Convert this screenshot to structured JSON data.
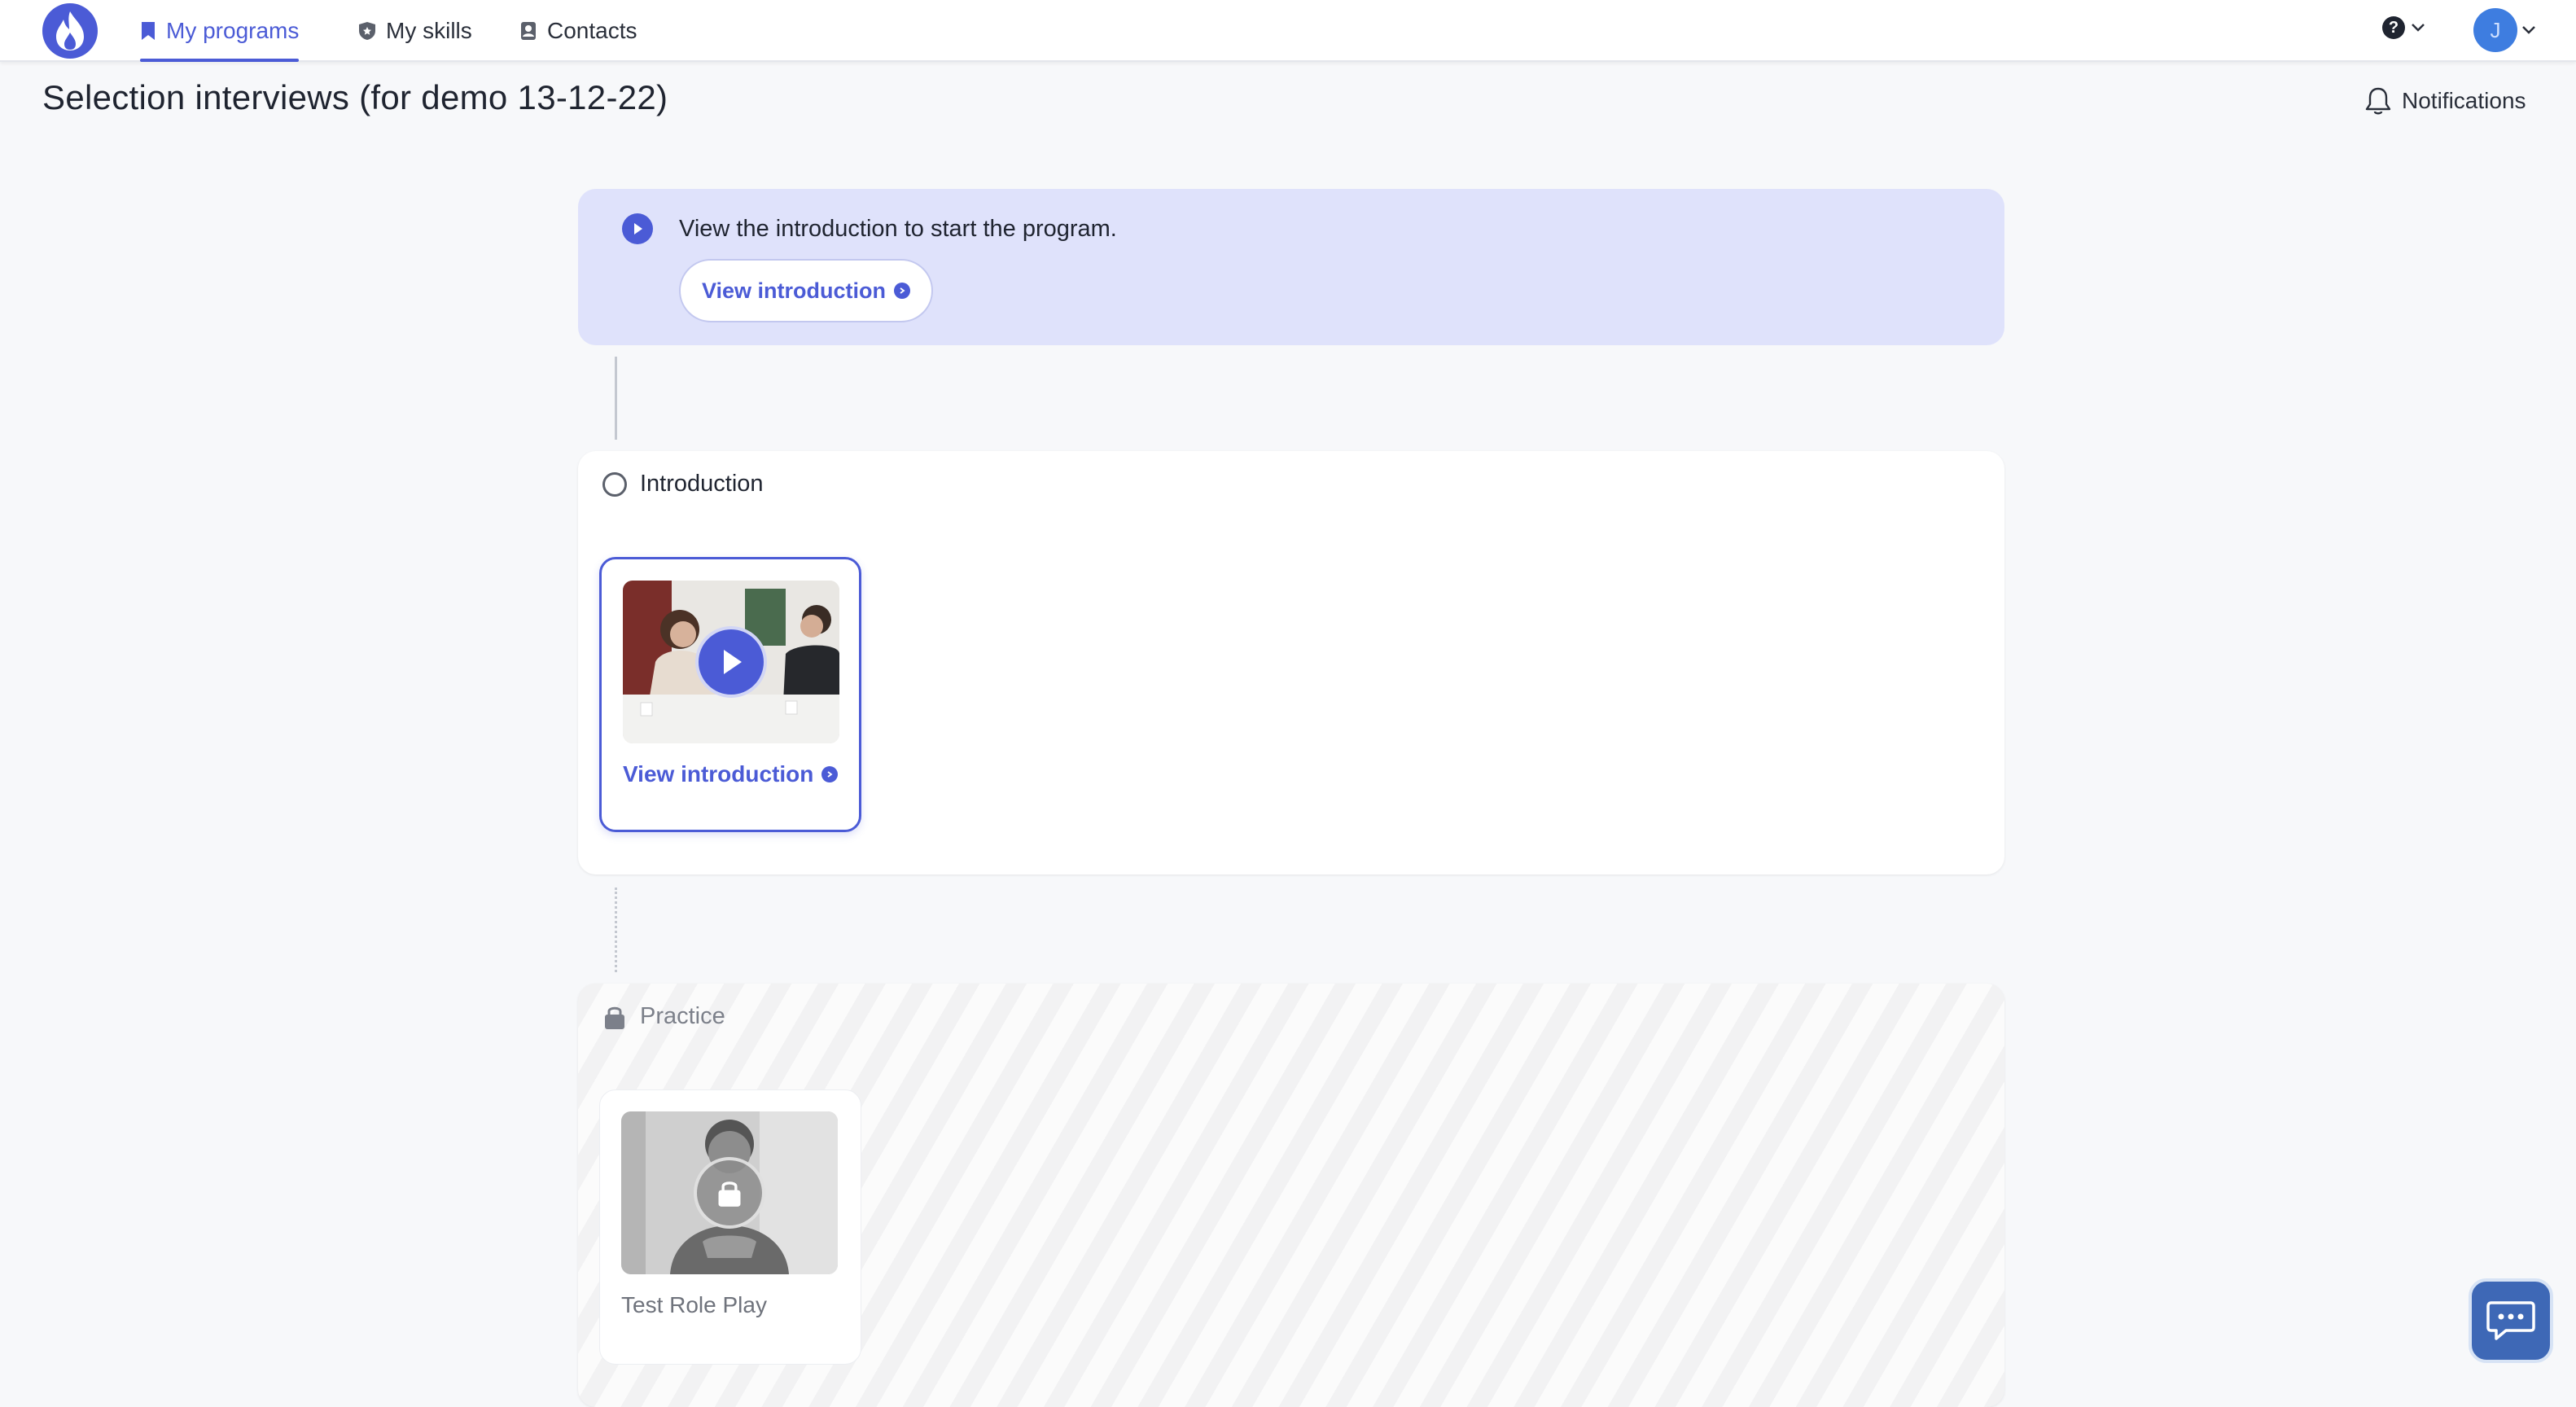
{
  "nav": {
    "items": [
      {
        "label": "My programs",
        "icon": "bookmark-icon",
        "active": true
      },
      {
        "label": "My skills",
        "icon": "shield-icon",
        "active": false
      },
      {
        "label": "Contacts",
        "icon": "contacts-icon",
        "active": false
      }
    ],
    "avatar_initial": "J",
    "help_glyph": "?"
  },
  "page": {
    "title": "Selection interviews (for demo 13-12-22)",
    "notifications_label": "Notifications"
  },
  "banner": {
    "message": "View the introduction to start the program.",
    "button_label": "View introduction"
  },
  "sections": {
    "intro": {
      "title": "Introduction",
      "status": "not-started",
      "tile": {
        "label": "View introduction",
        "state": "available",
        "icon": "play-icon"
      }
    },
    "practice": {
      "title": "Practice",
      "status": "locked",
      "tile": {
        "label": "Test Role Play",
        "state": "locked",
        "icon": "lock-icon"
      }
    }
  },
  "colors": {
    "brand": "#4b5bd6",
    "banner_bg": "#dfe2fb",
    "avatar": "#3e7de0",
    "chat": "#3e68b6"
  }
}
